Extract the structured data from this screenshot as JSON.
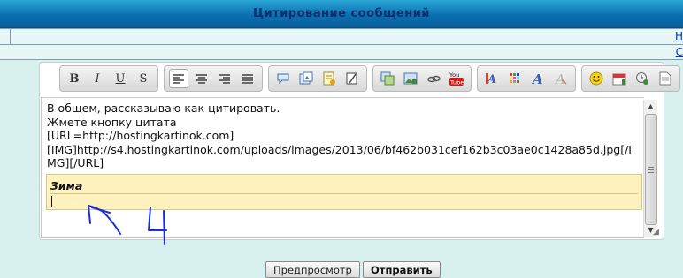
{
  "window": {
    "title": "Цитирование сообщений"
  },
  "edge_links": {
    "first": "Н",
    "second": "С"
  },
  "toolbar": {
    "bold": "B",
    "italic": "I",
    "underline": "U",
    "strike": "S",
    "icons": [
      "bold-icon",
      "italic-icon",
      "underline-icon",
      "strikethrough-icon",
      "align-left-icon",
      "align-center-icon",
      "align-right-icon",
      "justify-icon",
      "quote-icon",
      "image-insert-icon",
      "attach-note-icon",
      "edit-icon",
      "copy-icon",
      "image-icon",
      "link-icon",
      "youtube-icon",
      "text-color-icon",
      "color-palette-icon",
      "font-icon",
      "clear-format-icon",
      "smiley-icon",
      "calendar-icon",
      "clock-search-icon",
      "document-icon"
    ]
  },
  "editor": {
    "text": "В общем, рассказываю как цитировать.\nЖмете кнопку цитата\n[URL=http://hostingkartinok.com]\n[IMG]http://s4.hostingkartinok.com/uploads/images/2013/06/bf462b031cef162b3c03ae0c1428a85d.jpg[/IMG][/URL]",
    "quote_author": "Зима"
  },
  "buttons": {
    "preview": "Предпросмотр",
    "submit": "Отправить"
  },
  "colors": {
    "title_bar": "#0a6fb0",
    "title_text": "#0a2e6e",
    "quote_bg": "#fff2bd",
    "page_bg": "#d8f1ee",
    "scribble": "#1a2fd6"
  }
}
